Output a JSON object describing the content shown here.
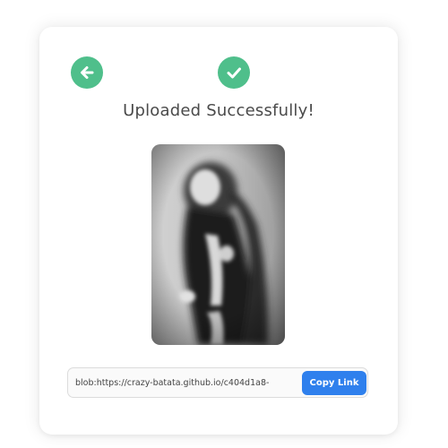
{
  "card": {
    "title": "Uploaded Successfully!"
  },
  "icons": {
    "back": "arrow-left-icon",
    "success": "check-icon"
  },
  "colors": {
    "accent_green": "#4fbf8b",
    "button_blue": "#2f80ed",
    "title_text": "#4a4a4a"
  },
  "uploaded_image": {
    "description": "blurred black-and-white portrait photo"
  },
  "link": {
    "value": "blob:https://crazy-batata.github.io/c404d1a8-",
    "copy_label": "Copy Link"
  }
}
